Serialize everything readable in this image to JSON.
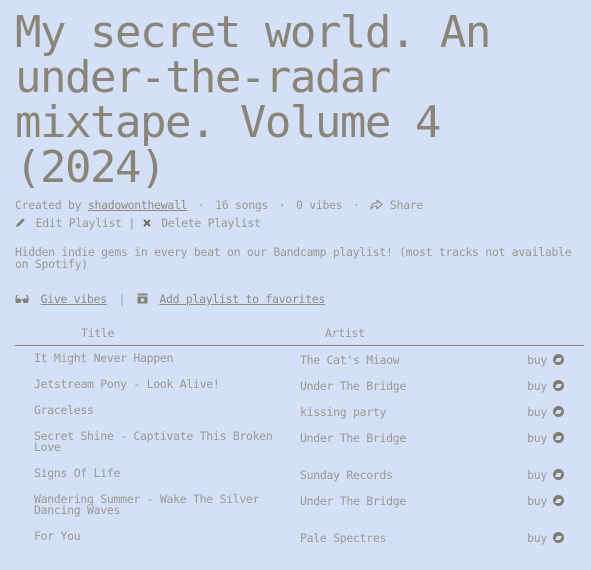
{
  "playlist": {
    "title": "My secret world. An under-the-radar mixtape. Volume 4 (2024)",
    "created_by_label": "Created by",
    "creator": "shadowonthewall",
    "songs_count": "16 songs",
    "vibes_count": "0 vibes",
    "share_label": "Share",
    "edit_label": "Edit Playlist",
    "delete_label": "Delete Playlist",
    "description": "Hidden indie gems in every beat on our Bandcamp playlist! (most tracks not available on Spotify)",
    "give_vibes_label": "Give vibes",
    "favorite_label": "Add playlist to favorites"
  },
  "icons": {
    "share": "share-icon",
    "edit": "pencil-icon",
    "delete": "x-icon",
    "vibes": "glasses-icon",
    "favorite": "archive-box-icon",
    "buy": "bandcamp-icon"
  },
  "table": {
    "headers": {
      "title": "Title",
      "artist": "Artist"
    },
    "buy_label": "buy",
    "rows": [
      {
        "title": "It Might Never Happen",
        "artist": "The Cat's Miaow"
      },
      {
        "title": "Jetstream Pony - Look Alive!",
        "artist": "Under The Bridge"
      },
      {
        "title": "Graceless",
        "artist": "kissing party"
      },
      {
        "title": "Secret Shine - Captivate This Broken Love",
        "artist": "Under The Bridge"
      },
      {
        "title": "Signs Of Life",
        "artist": "Sunday Records"
      },
      {
        "title": "Wandering Summer - Wake The Silver Dancing Waves",
        "artist": "Under The Bridge"
      },
      {
        "title": "For You",
        "artist": "Pale Spectres"
      }
    ]
  },
  "colors": {
    "background": "#d4e0f7",
    "title": "#8a8577",
    "text": "#9b9891"
  }
}
